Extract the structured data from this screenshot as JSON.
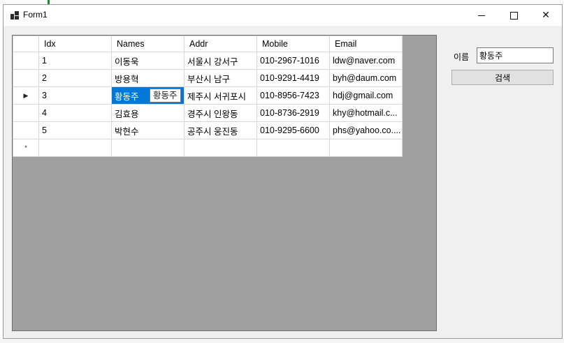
{
  "window": {
    "title": "Form1"
  },
  "grid": {
    "columns": [
      "Idx",
      "Names",
      "Addr",
      "Mobile",
      "Email"
    ],
    "rows": [
      {
        "idx": "1",
        "name": "이동욱",
        "addr": "서울시 강서구",
        "mobile": "010-2967-1016",
        "email": "ldw@naver.com"
      },
      {
        "idx": "2",
        "name": "방용혁",
        "addr": "부산시 남구",
        "mobile": "010-9291-4419",
        "email": "byh@daum.com"
      },
      {
        "idx": "3",
        "name": "황동주",
        "addr": "제주시 서귀포시",
        "mobile": "010-8956-7423",
        "email": "hdj@gmail.com"
      },
      {
        "idx": "4",
        "name": "김효용",
        "addr": "경주시 인왕동",
        "mobile": "010-8736-2919",
        "email": "khy@hotmail.c..."
      },
      {
        "idx": "5",
        "name": "박현수",
        "addr": "공주시 웅진동",
        "mobile": "010-9295-6600",
        "email": "phs@yahoo.co...."
      }
    ],
    "current_row_marker": "▶",
    "new_row_marker": "*",
    "editing_overlay": "황동주"
  },
  "search": {
    "label": "이름",
    "value": "황동주",
    "button_label": "검색"
  }
}
